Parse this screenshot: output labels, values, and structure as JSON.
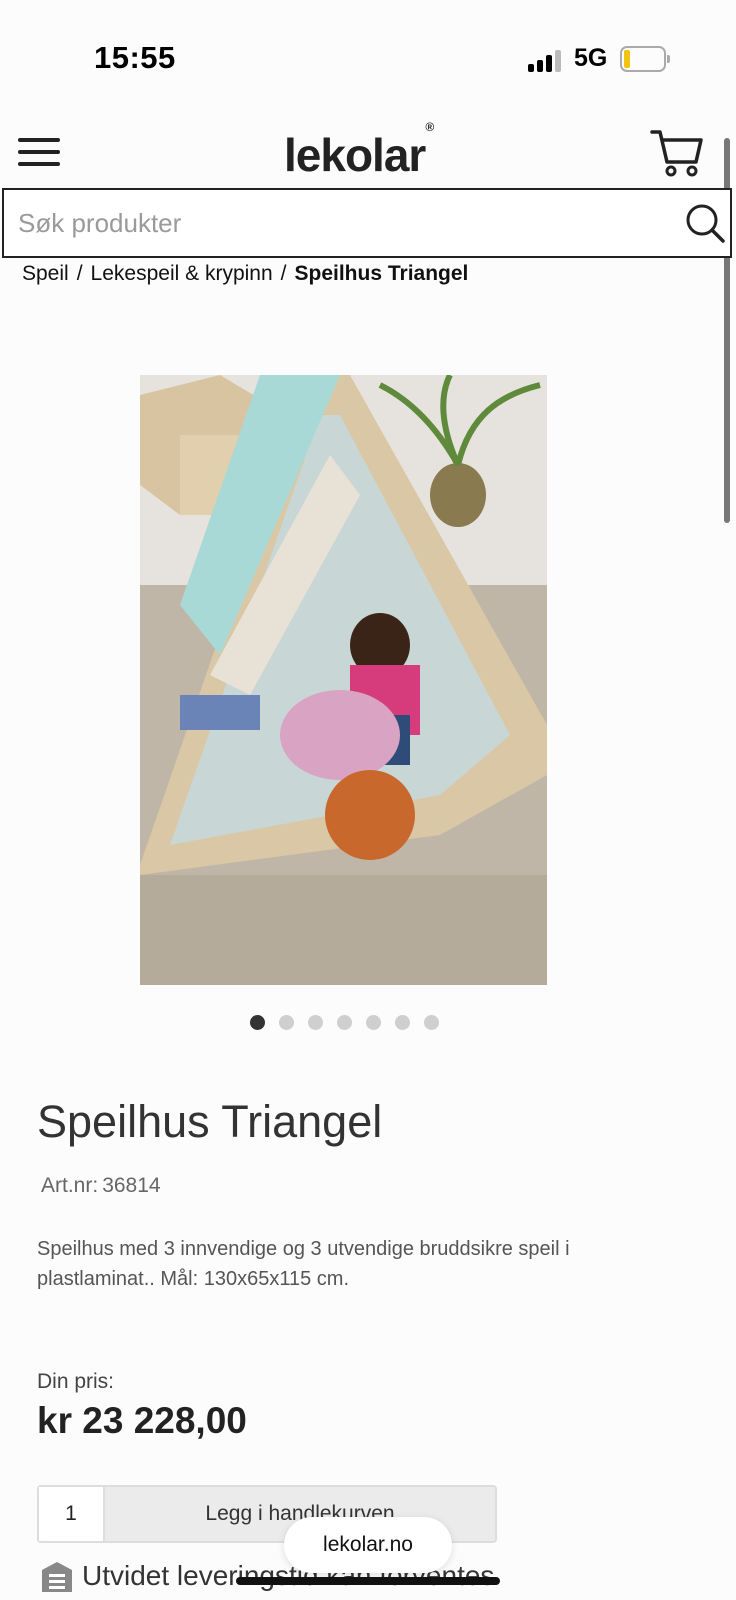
{
  "status_bar": {
    "time": "15:55",
    "network": "5G"
  },
  "header": {
    "logo": "lekolar",
    "logo_mark": "®"
  },
  "search": {
    "placeholder": "Søk produkter",
    "value": ""
  },
  "breadcrumb": {
    "items": [
      "Speil",
      "Lekespeil & krypinn"
    ],
    "separator": "/",
    "current": "Speilhus Triangel"
  },
  "carousel": {
    "total": 7,
    "active_index": 0
  },
  "product": {
    "title": "Speilhus Triangel",
    "artnr_label": "Art.nr:",
    "artnr": "36814",
    "description": "Speilhus med 3 innvendige og 3 utvendige bruddsikre speil i plastlaminat.. Mål: 130x65x115 cm.",
    "price_label": "Din pris:",
    "price": "kr 23 228,00",
    "quantity": "1",
    "add_to_cart_label": "Legg i handlekurven",
    "delivery_text": "Utvidet leveringstid kan forventes"
  },
  "browser": {
    "url": "lekolar.no"
  },
  "colors": {
    "text": "#222222",
    "muted": "#666666",
    "button_bg": "#ebebeb",
    "dot_active": "#333333",
    "dot_inactive": "#cfcfcf",
    "battery": "#f1c40f"
  }
}
